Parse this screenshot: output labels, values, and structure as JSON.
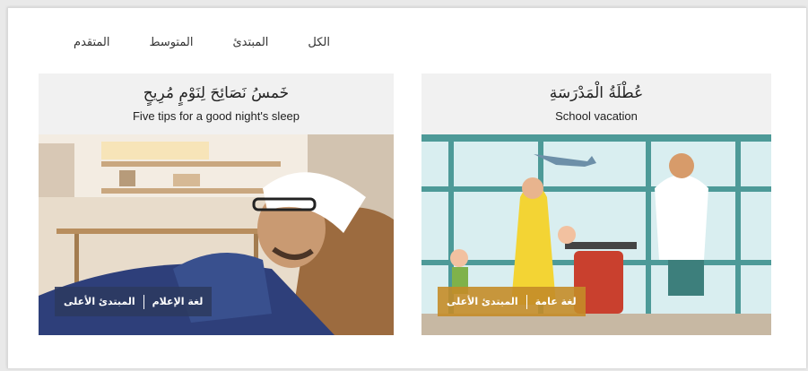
{
  "filters": [
    "الكل",
    "المبتدئ",
    "المتوسط",
    "المتقدم"
  ],
  "cards": [
    {
      "title_ar": "خَمسُ نَصَائِحَ لِنَوْمٍ مُرِيحٍ",
      "title_en": "Five tips for a good night's sleep",
      "badges": [
        "لغة الإعلام",
        "المبتدئ الأعلى"
      ]
    },
    {
      "title_ar": "عُطْلَةُ الْمَدْرَسَةِ",
      "title_en": "School vacation",
      "badges": [
        "لغة عامة",
        "المبتدئ الأعلى"
      ]
    }
  ]
}
